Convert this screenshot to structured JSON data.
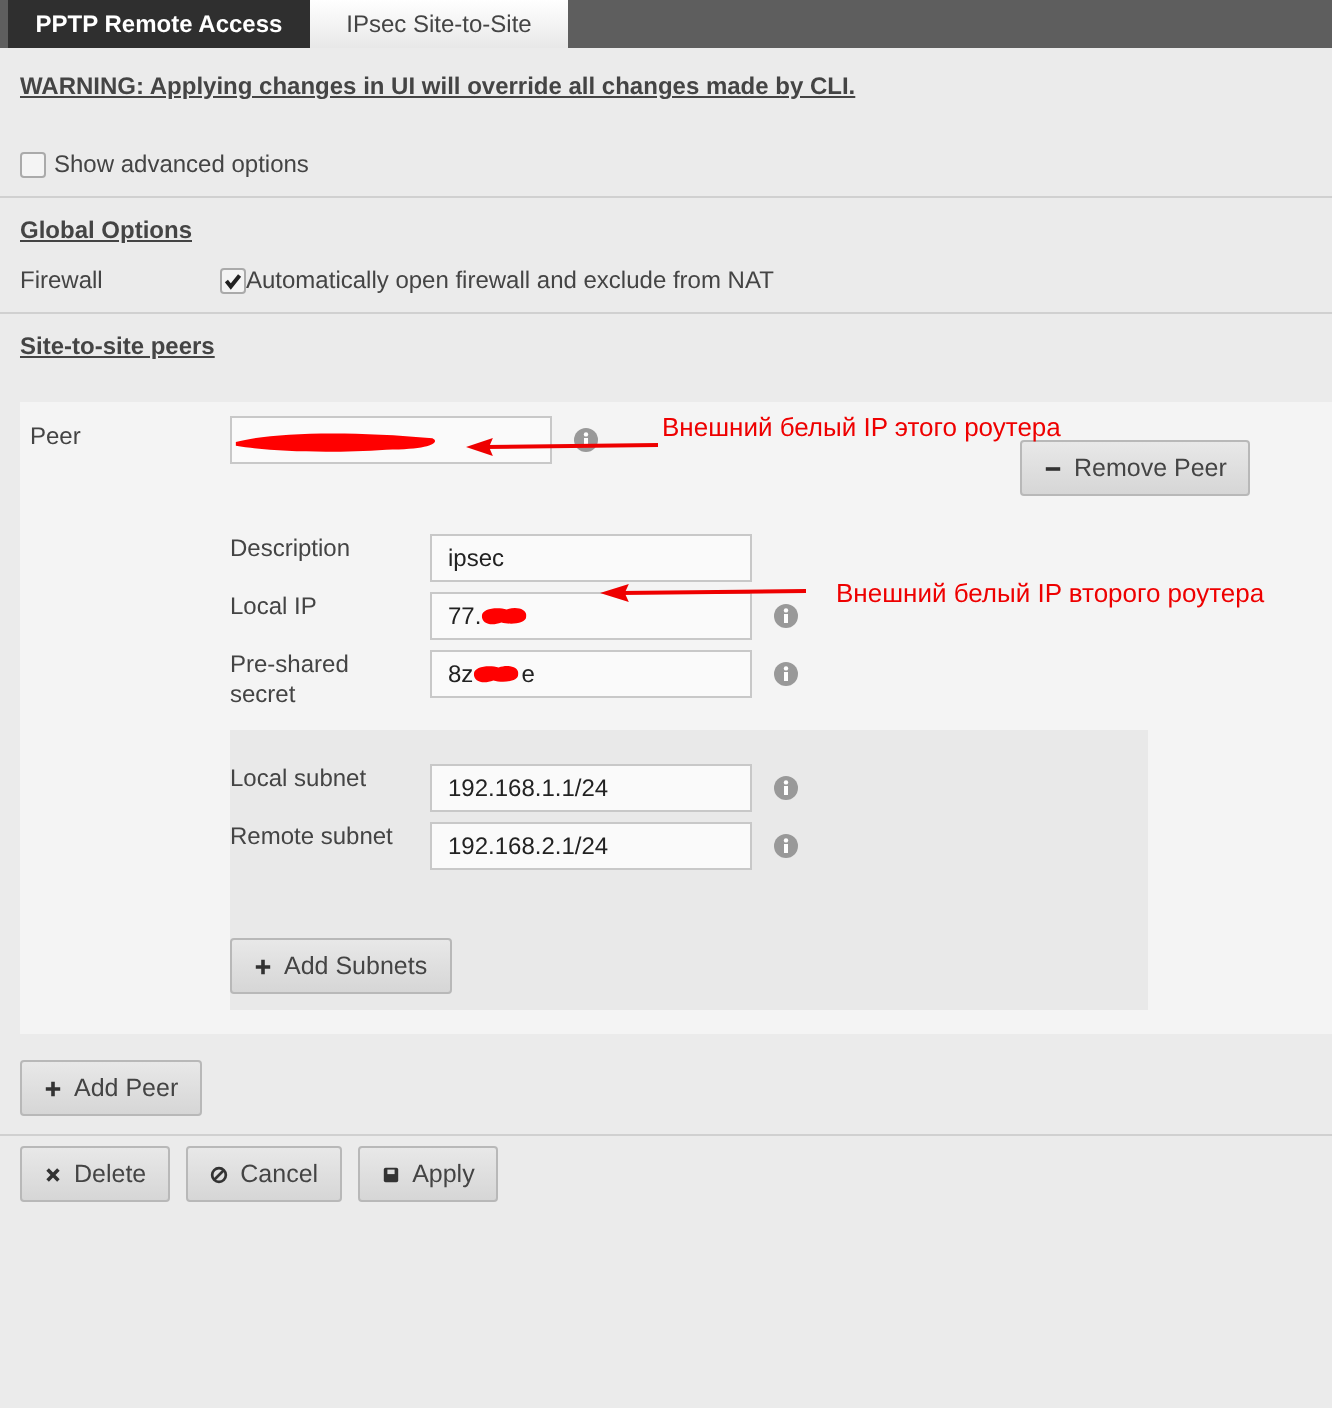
{
  "tabs": [
    {
      "label": "PPTP Remote Access",
      "selected": false
    },
    {
      "label": "IPsec Site-to-Site",
      "selected": true
    }
  ],
  "warning": "WARNING: Applying changes in UI will override all changes made by CLI.",
  "advanced": {
    "label": "Show advanced options",
    "checked": false
  },
  "global": {
    "heading": "Global Options",
    "label": "Firewall",
    "option": "Automatically open firewall and exclude from NAT",
    "checked": true
  },
  "peers_heading": "Site-to-site peers",
  "peer": {
    "label": "Peer",
    "redacted": true,
    "remove_button": "Remove Peer",
    "fields": [
      {
        "label": "Description",
        "value": "ipsec",
        "info": false,
        "redacted": false
      },
      {
        "label": "Local IP",
        "value": "77.",
        "info": true,
        "redacted": true
      },
      {
        "label": "Pre-shared secret",
        "value": "8z",
        "value_after": "e",
        "info": true,
        "redacted": true
      }
    ],
    "subnets": [
      {
        "label": "Local subnet",
        "value": "192.168.1.1/24"
      },
      {
        "label": "Remote subnet",
        "value": "192.168.2.1/24"
      }
    ],
    "add_subnets": "Add Subnets"
  },
  "add_peer": "Add Peer",
  "actions": [
    {
      "label": "Delete",
      "kind": "delete"
    },
    {
      "label": "Cancel",
      "kind": "cancel"
    },
    {
      "label": "Apply",
      "kind": "apply"
    }
  ],
  "annotations": [
    {
      "text": "Внешний белый IP этого роутера"
    },
    {
      "text": "Внешний белый IP второго роутера"
    }
  ]
}
